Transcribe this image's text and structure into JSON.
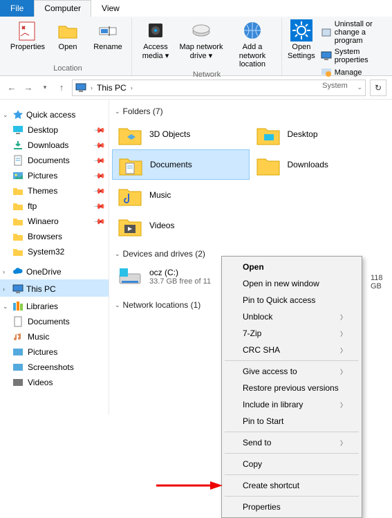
{
  "tabs": {
    "file": "File",
    "computer": "Computer",
    "view": "View"
  },
  "ribbon": {
    "location": {
      "name": "Location",
      "properties": "Properties",
      "open": "Open",
      "rename": "Rename"
    },
    "network": {
      "name": "Network",
      "access_media": "Access media ▾",
      "map_drive": "Map network drive ▾",
      "add_location": "Add a network location"
    },
    "system": {
      "name": "System",
      "open_settings": "Open Settings",
      "uninstall": "Uninstall or change a program",
      "sys_props": "System properties",
      "manage": "Manage"
    }
  },
  "addressbar": {
    "path": "This PC"
  },
  "nav": {
    "quick_access": "Quick access",
    "items": [
      {
        "label": "Desktop",
        "pinned": true
      },
      {
        "label": "Downloads",
        "pinned": true
      },
      {
        "label": "Documents",
        "pinned": true
      },
      {
        "label": "Pictures",
        "pinned": true
      },
      {
        "label": "Themes",
        "pinned": true
      },
      {
        "label": "ftp",
        "pinned": true
      },
      {
        "label": "Winaero",
        "pinned": true
      },
      {
        "label": "Browsers",
        "pinned": false
      },
      {
        "label": "System32",
        "pinned": false
      }
    ],
    "onedrive": "OneDrive",
    "this_pc": "This PC",
    "libraries": "Libraries",
    "lib_items": [
      {
        "label": "Documents"
      },
      {
        "label": "Music"
      },
      {
        "label": "Pictures"
      },
      {
        "label": "Screenshots"
      },
      {
        "label": "Videos"
      }
    ]
  },
  "content": {
    "folders_hdr": "Folders (7)",
    "folders": [
      {
        "label": "3D Objects"
      },
      {
        "label": "Desktop"
      },
      {
        "label": "Documents"
      },
      {
        "label": "Downloads"
      },
      {
        "label": "Music"
      },
      {
        "label": ""
      },
      {
        "label": "Videos"
      }
    ],
    "drives_hdr": "Devices and drives (2)",
    "drive1_name": "ocz (C:)",
    "drive1_sub": "33.7 GB free of 11",
    "drive2_sub": "118 GB",
    "netloc_hdr": "Network locations (1)"
  },
  "context_menu": {
    "open": "Open",
    "open_new": "Open in new window",
    "pin_qa": "Pin to Quick access",
    "unblock": "Unblock",
    "sevenzip": "7-Zip",
    "crc": "CRC SHA",
    "give_access": "Give access to",
    "restore": "Restore previous versions",
    "include_lib": "Include in library",
    "pin_start": "Pin to Start",
    "send_to": "Send to",
    "copy": "Copy",
    "shortcut": "Create shortcut",
    "properties": "Properties"
  }
}
